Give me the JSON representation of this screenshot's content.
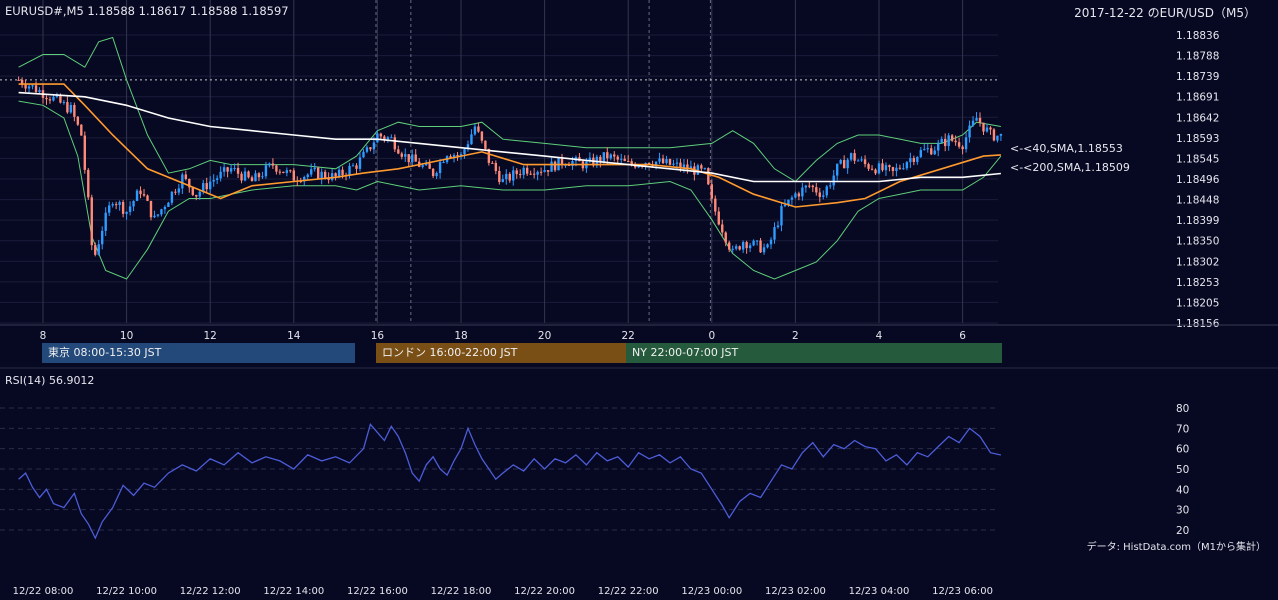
{
  "header": {
    "symbol_info": "EURUSD#,M5 1.18588 1.18617 1.18588 1.18597",
    "title": "2017-12-22 のEUR/USD（M5）"
  },
  "price_axis": {
    "ticks": [
      "1.18836",
      "1.18788",
      "1.18739",
      "1.18691",
      "1.18642",
      "1.18593",
      "1.18545",
      "1.18496",
      "1.18448",
      "1.18399",
      "1.18350",
      "1.18302",
      "1.18253",
      "1.18205",
      "1.18156"
    ],
    "min": 1.18156,
    "max": 1.18836
  },
  "hour_axis": {
    "labels": [
      "8",
      "10",
      "12",
      "14",
      "16",
      "18",
      "20",
      "22",
      "0",
      "2",
      "4",
      "6"
    ]
  },
  "sessions": [
    {
      "label": "東京 08:00-15:30 JST",
      "color": "#22497a"
    },
    {
      "label": "ロンドン 16:00-22:00 JST",
      "color": "#7a4f16"
    },
    {
      "label": "NY 22:00-07:00 JST",
      "color": "#265a3c"
    }
  ],
  "ma_labels": {
    "sma40": "<-<40,SMA,1.18553",
    "sma200": "<-<200,SMA,1.18509",
    "sma40_color": "#ff9a2e",
    "sma200_color": "#ffffff"
  },
  "rsi": {
    "label": "RSI(14) 56.9012",
    "ticks": [
      "80",
      "70",
      "60",
      "50",
      "40",
      "30",
      "20"
    ],
    "line_color": "#4c5dd8"
  },
  "time_axis": {
    "labels": [
      "12/22 08:00",
      "12/22 10:00",
      "12/22 12:00",
      "12/22 14:00",
      "12/22 16:00",
      "12/22 18:00",
      "12/22 20:00",
      "12/22 22:00",
      "12/23 00:00",
      "12/23 02:00",
      "12/23 04:00",
      "12/23 06:00"
    ]
  },
  "credit": "データ: HistData.com（M1から集計）",
  "chart_data": [
    {
      "type": "candlestick",
      "title": "2017-12-22 のEUR/USD（M5）",
      "x_labels": [
        "8",
        "10",
        "12",
        "14",
        "16",
        "18",
        "20",
        "22",
        "0",
        "2",
        "4",
        "6"
      ],
      "ylim": [
        1.18156,
        1.18836
      ],
      "up_color": "#2e9bff",
      "down_color": "#ff8a78",
      "close_path": [
        [
          "07:25",
          1.1873
        ],
        [
          "08:00",
          1.187
        ],
        [
          "08:40",
          1.1866
        ],
        [
          "08:55",
          1.186
        ],
        [
          "09:05",
          1.1844
        ],
        [
          "09:12",
          1.183
        ],
        [
          "09:25",
          1.1838
        ],
        [
          "09:40",
          1.1845
        ],
        [
          "10:00",
          1.1842
        ],
        [
          "10:20",
          1.1847
        ],
        [
          "10:40",
          1.184
        ],
        [
          "11:00",
          1.1845
        ],
        [
          "11:20",
          1.185
        ],
        [
          "11:40",
          1.1846
        ],
        [
          "12:00",
          1.1849
        ],
        [
          "12:30",
          1.1852
        ],
        [
          "13:00",
          1.1849
        ],
        [
          "13:30",
          1.1853
        ],
        [
          "14:00",
          1.185
        ],
        [
          "14:30",
          1.1851
        ],
        [
          "15:00",
          1.185
        ],
        [
          "15:30",
          1.1853
        ],
        [
          "15:45",
          1.1856
        ],
        [
          "16:00",
          1.186
        ],
        [
          "16:20",
          1.1859
        ],
        [
          "16:40",
          1.1855
        ],
        [
          "17:00",
          1.1853
        ],
        [
          "17:20",
          1.1851
        ],
        [
          "17:40",
          1.1856
        ],
        [
          "18:00",
          1.1855
        ],
        [
          "18:20",
          1.1862
        ],
        [
          "18:40",
          1.1854
        ],
        [
          "19:00",
          1.1849
        ],
        [
          "19:30",
          1.1852
        ],
        [
          "20:00",
          1.1852
        ],
        [
          "20:30",
          1.1854
        ],
        [
          "21:00",
          1.1853
        ],
        [
          "21:30",
          1.1855
        ],
        [
          "22:00",
          1.1853
        ],
        [
          "22:30",
          1.1854
        ],
        [
          "23:00",
          1.1853
        ],
        [
          "23:30",
          1.1852
        ],
        [
          "23:50",
          1.1851
        ],
        [
          "00:00",
          1.1844
        ],
        [
          "00:15",
          1.1838
        ],
        [
          "00:30",
          1.1832
        ],
        [
          "00:45",
          1.1835
        ],
        [
          "01:00",
          1.1834
        ],
        [
          "01:20",
          1.1833
        ],
        [
          "01:40",
          1.1842
        ],
        [
          "02:00",
          1.1846
        ],
        [
          "02:20",
          1.1848
        ],
        [
          "02:40",
          1.1846
        ],
        [
          "03:00",
          1.1852
        ],
        [
          "03:20",
          1.1855
        ],
        [
          "03:40",
          1.1853
        ],
        [
          "04:00",
          1.1852
        ],
        [
          "04:20",
          1.1851
        ],
        [
          "04:40",
          1.1854
        ],
        [
          "05:00",
          1.1856
        ],
        [
          "05:20",
          1.1857
        ],
        [
          "05:40",
          1.1859
        ],
        [
          "06:00",
          1.1858
        ],
        [
          "06:20",
          1.1864
        ],
        [
          "06:40",
          1.186
        ],
        [
          "06:55",
          1.18597
        ]
      ]
    },
    {
      "type": "line",
      "name": "40,SMA",
      "color": "#ff9a2e",
      "points": [
        [
          "07:25",
          1.1872
        ],
        [
          "08:30",
          1.1872
        ],
        [
          "09:00",
          1.1867
        ],
        [
          "09:40",
          1.186
        ],
        [
          "10:30",
          1.1852
        ],
        [
          "11:30",
          1.1848
        ],
        [
          "12:15",
          1.1845
        ],
        [
          "13:00",
          1.1848
        ],
        [
          "14:00",
          1.1849
        ],
        [
          "15:00",
          1.185
        ],
        [
          "15:40",
          1.1851
        ],
        [
          "16:30",
          1.1852
        ],
        [
          "17:30",
          1.1854
        ],
        [
          "18:30",
          1.1856
        ],
        [
          "19:30",
          1.1853
        ],
        [
          "20:30",
          1.1853
        ],
        [
          "21:30",
          1.1853
        ],
        [
          "22:30",
          1.1853
        ],
        [
          "23:30",
          1.1852
        ],
        [
          "00:10",
          1.185
        ],
        [
          "01:00",
          1.1846
        ],
        [
          "02:00",
          1.1843
        ],
        [
          "03:00",
          1.1844
        ],
        [
          "03:40",
          1.1845
        ],
        [
          "04:30",
          1.1849
        ],
        [
          "05:30",
          1.1852
        ],
        [
          "06:30",
          1.1855
        ],
        [
          "06:55",
          1.18553
        ]
      ]
    },
    {
      "type": "line",
      "name": "200,SMA",
      "color": "#ffffff",
      "points": [
        [
          "07:25",
          1.187
        ],
        [
          "09:00",
          1.1869
        ],
        [
          "10:00",
          1.1867
        ],
        [
          "11:00",
          1.1864
        ],
        [
          "12:00",
          1.1862
        ],
        [
          "13:00",
          1.1861
        ],
        [
          "14:00",
          1.186
        ],
        [
          "15:00",
          1.1859
        ],
        [
          "16:00",
          1.1859
        ],
        [
          "17:00",
          1.1858
        ],
        [
          "18:00",
          1.1857
        ],
        [
          "19:00",
          1.1856
        ],
        [
          "20:00",
          1.1855
        ],
        [
          "21:00",
          1.1854
        ],
        [
          "22:00",
          1.1853
        ],
        [
          "23:00",
          1.1852
        ],
        [
          "00:00",
          1.1851
        ],
        [
          "01:00",
          1.1849
        ],
        [
          "02:00",
          1.1849
        ],
        [
          "03:00",
          1.1849
        ],
        [
          "04:00",
          1.1849
        ],
        [
          "05:00",
          1.185
        ],
        [
          "06:00",
          1.185
        ],
        [
          "06:55",
          1.18509
        ]
      ]
    },
    {
      "type": "line",
      "name": "bollinger upper",
      "color": "#5fcf7a",
      "points": [
        [
          "07:25",
          1.1876
        ],
        [
          "08:00",
          1.1879
        ],
        [
          "08:30",
          1.1879
        ],
        [
          "09:00",
          1.1876
        ],
        [
          "09:20",
          1.1882
        ],
        [
          "09:40",
          1.1883
        ],
        [
          "10:00",
          1.1873
        ],
        [
          "10:30",
          1.186
        ],
        [
          "11:00",
          1.1851
        ],
        [
          "11:30",
          1.1852
        ],
        [
          "12:00",
          1.1854
        ],
        [
          "12:30",
          1.1853
        ],
        [
          "13:00",
          1.1853
        ],
        [
          "14:00",
          1.1853
        ],
        [
          "15:00",
          1.1852
        ],
        [
          "15:30",
          1.1855
        ],
        [
          "16:00",
          1.1861
        ],
        [
          "16:30",
          1.1863
        ],
        [
          "17:00",
          1.1862
        ],
        [
          "18:00",
          1.1862
        ],
        [
          "18:30",
          1.1863
        ],
        [
          "19:00",
          1.1859
        ],
        [
          "20:00",
          1.1858
        ],
        [
          "21:00",
          1.1857
        ],
        [
          "22:00",
          1.1857
        ],
        [
          "23:00",
          1.1857
        ],
        [
          "00:00",
          1.1858
        ],
        [
          "00:30",
          1.1861
        ],
        [
          "01:00",
          1.1858
        ],
        [
          "01:30",
          1.1852
        ],
        [
          "02:00",
          1.1849
        ],
        [
          "02:30",
          1.1854
        ],
        [
          "03:00",
          1.1858
        ],
        [
          "03:30",
          1.186
        ],
        [
          "04:00",
          1.186
        ],
        [
          "05:00",
          1.1858
        ],
        [
          "05:30",
          1.1858
        ],
        [
          "06:00",
          1.186
        ],
        [
          "06:20",
          1.1863
        ],
        [
          "06:55",
          1.1862
        ]
      ]
    },
    {
      "type": "line",
      "name": "bollinger lower",
      "color": "#5fcf7a",
      "points": [
        [
          "07:25",
          1.1868
        ],
        [
          "08:00",
          1.1867
        ],
        [
          "08:30",
          1.1864
        ],
        [
          "08:50",
          1.1855
        ],
        [
          "09:10",
          1.1836
        ],
        [
          "09:30",
          1.1828
        ],
        [
          "10:00",
          1.1826
        ],
        [
          "10:30",
          1.1833
        ],
        [
          "11:00",
          1.1842
        ],
        [
          "11:30",
          1.1845
        ],
        [
          "12:00",
          1.1845
        ],
        [
          "13:00",
          1.1847
        ],
        [
          "14:00",
          1.1848
        ],
        [
          "15:00",
          1.1848
        ],
        [
          "15:30",
          1.1847
        ],
        [
          "16:00",
          1.1849
        ],
        [
          "16:30",
          1.1848
        ],
        [
          "17:00",
          1.1847
        ],
        [
          "18:00",
          1.1848
        ],
        [
          "19:00",
          1.1847
        ],
        [
          "20:00",
          1.1847
        ],
        [
          "21:00",
          1.1848
        ],
        [
          "22:00",
          1.1848
        ],
        [
          "23:00",
          1.1849
        ],
        [
          "23:30",
          1.1847
        ],
        [
          "00:00",
          1.184
        ],
        [
          "00:30",
          1.1832
        ],
        [
          "01:00",
          1.1828
        ],
        [
          "01:30",
          1.1826
        ],
        [
          "02:00",
          1.1828
        ],
        [
          "02:30",
          1.183
        ],
        [
          "03:00",
          1.1835
        ],
        [
          "03:30",
          1.1842
        ],
        [
          "04:00",
          1.1845
        ],
        [
          "05:00",
          1.1847
        ],
        [
          "06:00",
          1.1847
        ],
        [
          "06:30",
          1.185
        ],
        [
          "06:55",
          1.1855
        ]
      ]
    },
    {
      "type": "line",
      "title": "RSI(14) 56.9012",
      "ylim": [
        15,
        85
      ],
      "points": [
        [
          "07:25",
          45
        ],
        [
          "07:35",
          48
        ],
        [
          "07:45",
          41
        ],
        [
          "07:55",
          36
        ],
        [
          "08:05",
          40
        ],
        [
          "08:15",
          33
        ],
        [
          "08:30",
          31
        ],
        [
          "08:45",
          38
        ],
        [
          "08:55",
          28
        ],
        [
          "09:05",
          23
        ],
        [
          "09:15",
          16
        ],
        [
          "09:25",
          24
        ],
        [
          "09:40",
          31
        ],
        [
          "09:55",
          42
        ],
        [
          "10:10",
          37
        ],
        [
          "10:25",
          43
        ],
        [
          "10:40",
          41
        ],
        [
          "11:00",
          48
        ],
        [
          "11:20",
          52
        ],
        [
          "11:40",
          49
        ],
        [
          "12:00",
          55
        ],
        [
          "12:20",
          52
        ],
        [
          "12:40",
          58
        ],
        [
          "13:00",
          53
        ],
        [
          "13:20",
          56
        ],
        [
          "13:40",
          54
        ],
        [
          "14:00",
          50
        ],
        [
          "14:20",
          57
        ],
        [
          "14:40",
          54
        ],
        [
          "15:00",
          56
        ],
        [
          "15:20",
          53
        ],
        [
          "15:40",
          60
        ],
        [
          "15:50",
          72
        ],
        [
          "16:00",
          68
        ],
        [
          "16:10",
          64
        ],
        [
          "16:20",
          71
        ],
        [
          "16:30",
          66
        ],
        [
          "16:40",
          58
        ],
        [
          "16:50",
          48
        ],
        [
          "17:00",
          44
        ],
        [
          "17:10",
          52
        ],
        [
          "17:20",
          56
        ],
        [
          "17:30",
          50
        ],
        [
          "17:40",
          47
        ],
        [
          "17:50",
          54
        ],
        [
          "18:00",
          60
        ],
        [
          "18:10",
          70
        ],
        [
          "18:20",
          62
        ],
        [
          "18:30",
          55
        ],
        [
          "18:40",
          50
        ],
        [
          "18:50",
          45
        ],
        [
          "19:00",
          48
        ],
        [
          "19:15",
          52
        ],
        [
          "19:30",
          49
        ],
        [
          "19:45",
          55
        ],
        [
          "20:00",
          50
        ],
        [
          "20:15",
          55
        ],
        [
          "20:30",
          53
        ],
        [
          "20:45",
          57
        ],
        [
          "21:00",
          52
        ],
        [
          "21:15",
          58
        ],
        [
          "21:30",
          54
        ],
        [
          "21:45",
          56
        ],
        [
          "22:00",
          51
        ],
        [
          "22:15",
          58
        ],
        [
          "22:30",
          55
        ],
        [
          "22:45",
          57
        ],
        [
          "23:00",
          53
        ],
        [
          "23:15",
          56
        ],
        [
          "23:30",
          50
        ],
        [
          "23:45",
          48
        ],
        [
          "00:00",
          40
        ],
        [
          "00:15",
          32
        ],
        [
          "00:25",
          26
        ],
        [
          "00:40",
          34
        ],
        [
          "00:55",
          38
        ],
        [
          "01:10",
          36
        ],
        [
          "01:25",
          44
        ],
        [
          "01:40",
          52
        ],
        [
          "01:55",
          50
        ],
        [
          "02:10",
          58
        ],
        [
          "02:25",
          63
        ],
        [
          "02:40",
          56
        ],
        [
          "02:55",
          62
        ],
        [
          "03:10",
          60
        ],
        [
          "03:25",
          64
        ],
        [
          "03:40",
          61
        ],
        [
          "03:55",
          60
        ],
        [
          "04:10",
          54
        ],
        [
          "04:25",
          57
        ],
        [
          "04:40",
          52
        ],
        [
          "04:55",
          58
        ],
        [
          "05:10",
          56
        ],
        [
          "05:25",
          61
        ],
        [
          "05:40",
          66
        ],
        [
          "05:55",
          63
        ],
        [
          "06:10",
          70
        ],
        [
          "06:25",
          66
        ],
        [
          "06:40",
          58
        ],
        [
          "06:55",
          56.9
        ]
      ]
    }
  ]
}
